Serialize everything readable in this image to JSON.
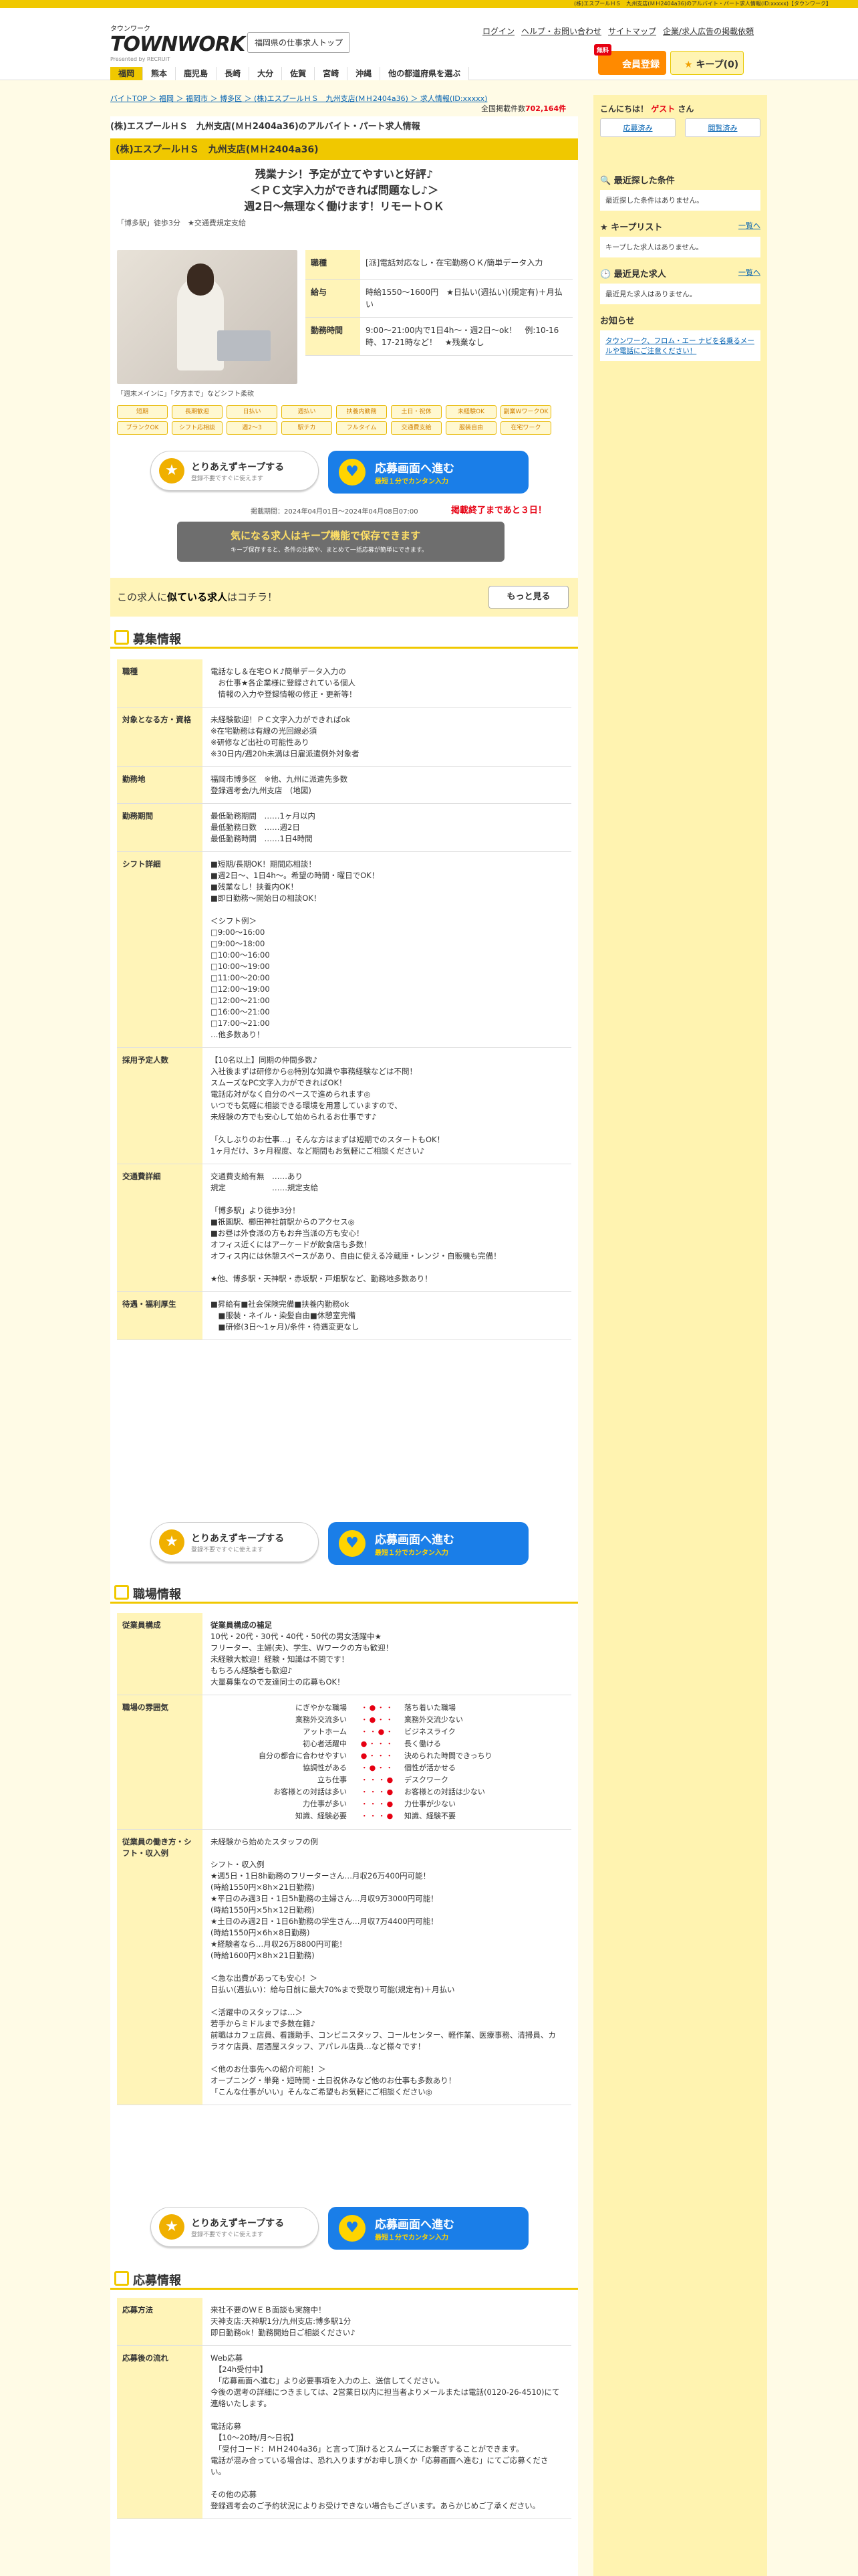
{
  "topbar": "(株)エスプールＨＳ　九州支店(ＭＨ2404a36)のアルバイト・パート求人情報(ID:xxxxx)【タウンワーク】",
  "header": {
    "logo_small": "タウンワーク",
    "logo_big": "TOWNWORK",
    "logo_by": "Presented by RECRUIT",
    "local_button": "福岡県の仕事求人トップ",
    "links": [
      "ログイン",
      "ヘルプ・お問い合わせ",
      "サイトマップ",
      "企業/求人広告の掲載依頼"
    ],
    "member_tag": "無料",
    "member": "会員登録",
    "keep": "キープ(0)"
  },
  "nav": [
    "福岡",
    "熊本",
    "鹿児島",
    "長崎",
    "大分",
    "佐賀",
    "宮崎",
    "沖縄",
    "他の都道府県を選ぶ"
  ],
  "breadcrumb": "バイトTOP ＞ 福岡 ＞ 福岡市 ＞ 博多区 ＞ (株)エスプールＨＳ　九州支店(ＭＨ2404a36) ＞ 求人情報(ID:xxxxx)",
  "count_label": "全国掲載件数",
  "count": "702,164件",
  "job": {
    "title": "(株)エスプールＨＳ　九州支店(ＭＨ2404a36)のアルバイト・パート求人情報",
    "bar": "(株)エスプールＨＳ　九州支店(ＭＨ2404a36)",
    "catch1": "残業ナシ！予定が立てやすいと好評♪",
    "catch2": "＜ＰＣ文字入力ができれば問題なし♪＞",
    "catch3": "週2日～無理なく働けます！リモートＯＫ",
    "sub": "「博多駅」徒歩3分　★交通費規定支給",
    "photo_caption": "「週末メインに」「夕方まで」などシフト柔軟",
    "summary": [
      {
        "k": "職種",
        "v": "[派]電話対応なし・在宅勤務ＯＫ/簡単データ入力"
      },
      {
        "k": "給与",
        "v": "時給1550～1600円　★日払い(週払い)(規定有)＋月払い"
      },
      {
        "k": "勤務時間",
        "v": "9:00～21:00内で1日4h～・週2日～ok！　例:10-16時、17-21時など！　★残業なし"
      }
    ],
    "tags": [
      "短期",
      "長期歓迎",
      "日払い",
      "週払い",
      "扶養内勤務",
      "土日・祝休",
      "未経験OK",
      "副業WワークOK",
      "ブランクOK",
      "シフト応相談",
      "週2〜3",
      "駅チカ",
      "フルタイム",
      "交通費支給",
      "服装自由",
      "在宅ワーク"
    ],
    "keep_btn": "とりあえずキープする",
    "keep_sub": "登録不要ですぐに使えます",
    "apply_btn": "応募画面へ進む",
    "apply_sub": "最短１分でカンタン入力",
    "period": "掲載期間：2024年04月01日～2024年04月08日07:00",
    "remain": "掲載終了まであと３日！",
    "banner_title": "気になる求人はキープ機能で保存できます",
    "banner_sub": "キープ保存すると、条件の比較や、まとめて一括応募が簡単にできます。",
    "similar": "この求人に",
    "similar_b": "似ている求人",
    "similar2": "はコチラ！",
    "more": "もっと見る"
  },
  "sections": {
    "bosyu": "募集情報",
    "shokuba": "職場情報",
    "oubo": "応募情報"
  },
  "bosyu": [
    {
      "k": "職種",
      "v": "電話なし＆在宅ＯＫ♪簡単データ入力の\n　お仕事★各企業様に登録されている個人\n　情報の入力や登録情報の修正・更新等！"
    },
    {
      "k": "対象となる方・資格",
      "v": "未経験歓迎！ＰＣ文字入力ができればok\n※在宅勤務は有線の光回線必須\n※研修など出社の可能性あり\n※30日内/週20h未満は日雇派遣例外対象者"
    },
    {
      "k": "勤務地",
      "v": "福岡市博多区　※他、九州に派遣先多数\n登録週考会/九州支店　(地図)"
    },
    {
      "k": "勤務期間",
      "v": "最低勤務期間　……1ヶ月以内\n最低勤務日数　……週2日\n最低勤務時間　……1日4時間"
    },
    {
      "k": "シフト詳細",
      "v": "■短期/長期OK！期間応相談！\n■週2日～、1日4h～。希望の時間・曜日でOK！\n■残業なし！扶養内OK！\n■即日勤務～開始日の相談OK！\n\n＜シフト例＞\n□9:00～16:00\n□9:00～18:00\n□10:00～16:00\n□10:00～19:00\n□11:00～20:00\n□12:00～19:00\n□12:00～21:00\n□16:00～21:00\n□17:00～21:00\n…他多数あり！"
    },
    {
      "k": "採用予定人数",
      "v": "【10名以上】同期の仲間多数♪\n入社後まずは研修から◎特別な知識や事務経験などは不問！\nスムーズなPC文字入力ができればOK！\n電話応対がなく自分のペースで進められます◎\nいつでも気軽に相談できる環境を用意していますので、\n未経験の方でも安心して始められるお仕事です♪\n\n「久しぶりのお仕事…」そんな方はまずは短期でのスタートもOK！\n1ヶ月だけ、3ヶ月程度、など期間もお気軽にご相談ください♪"
    },
    {
      "k": "交通費詳細",
      "v": "交通費支給有無　……あり\n規定　　　　　　……規定支給\n\n「博多駅」より徒歩3分！\n■祇園駅、櫛田神社前駅からのアクセス◎\n■お昼は外食派の方もお弁当派の方も安心！\nオフィス近くにはアーケードが飲食店も多数！\nオフィス内には休憩スペースがあり、自由に使える冷蔵庫・レンジ・自販機も完備！\n\n★他、博多駅・天神駅・赤坂駅・戸畑駅など、勤務地多数あり！"
    },
    {
      "k": "待遇・福利厚生",
      "v": "■昇給有■社会保険完備■扶養内勤務ok\n　■服装・ネイル・染髪自由■休憩室完備\n　■研修(3日～1ヶ月)/条件・待遇変更なし"
    }
  ],
  "shokuba_comp_head": "従業員構成の補足",
  "shokuba_comp": "10代・20代・30代・40代・50代の男女活躍中★\nフリーター、主婦(夫)、学生、Wワークの方も歓迎！\n未経験大歓迎！経験・知識は不問です！\nもちろん経験者も歓迎♪\n大量募集なので友達同士の応募もOK！",
  "mood": [
    [
      "にぎやかな職場",
      "落ち着いた職場"
    ],
    [
      "業務外交流多い",
      "業務外交流少ない"
    ],
    [
      "アットホーム",
      "ビジネスライク"
    ],
    [
      "初心者活躍中",
      "長く働ける"
    ],
    [
      "自分の都合に合わせやすい",
      "決められた時間できっちり"
    ],
    [
      "協調性がある",
      "個性が活かせる"
    ],
    [
      "立ち仕事",
      "デスクワーク"
    ],
    [
      "お客様との対話は多い",
      "お客様との対話は少ない"
    ],
    [
      "力仕事が多い",
      "力仕事が少ない"
    ],
    [
      "知識、経験必要",
      "知識、経験不要"
    ]
  ],
  "shokuba_rows": [
    {
      "k": "従業員構成"
    },
    {
      "k": "職場の雰囲気"
    },
    {
      "k": "従業員の働き方・シフト・収入例",
      "v": "未経験から始めたスタッフの例\n\nシフト・収入例\n★週5日・1日8h勤務のフリーターさん…月収26万400円可能！\n(時給1550円×8h×21日勤務)\n★平日のみ週3日・1日5h勤務の主婦さん…月収9万3000円可能！\n(時給1550円×5h×12日勤務)\n★土日のみ週2日・1日6h勤務の学生さん…月収7万4400円可能！\n(時給1550円×6h×8日勤務)\n★経験者なら…月収26万8800円可能！\n(時給1600円×8h×21日勤務)\n\n＜急な出費があっても安心！＞\n日払い(週払い)：給与日前に最大70%まで受取り可能(規定有)＋月払い\n\n＜活躍中のスタッフは…＞\n若手からミドルまで多数在籍♪\n前職はカフェ店員、看護助手、コンビニスタッフ、コールセンター、軽作業、医療事務、清掃員、カラオケ店員、居酒屋スタッフ、アパレル店員…など様々です！\n\n＜他のお仕事先への紹介可能！＞\nオープニング・単発・短時間・土日祝休みなど他のお仕事も多数あり！\n「こんな仕事がいい」そんなご希望もお気軽にご相談ください◎"
    }
  ],
  "oubo": [
    {
      "k": "応募方法",
      "v": "来社不要のＷＥＢ面談も実施中！\n天神支店:天神駅1分/九州支店:博多駅1分\n即日勤務ok！勤務開始日ご相談ください♪"
    },
    {
      "k": "応募後の流れ",
      "v": "Web応募\n　【24h受付中】\n　「応募画面へ進む」より必要事項を入力の上、送信してください。\n今後の選考の詳細につきましては、2営業日以内に担当者よりメールまたは電話(0120-26-4510)にて連絡いたします。\n\n電話応募\n　【10～20時/月～日祝】\n　「受付コード：ＭＨ2404a36」と言って頂けるとスムーズにお繋ぎすることができます。\n電話が混み合っている場合は、恐れ入りますがお申し頂くか「応募画面へ進む」にてご応募ください。\n\nその他の応募\n登録週考会のご予約状況によりお受けできない場合もございます。あらかじめご了承ください。"
    }
  ],
  "side": {
    "hello": "こんにちは！",
    "guest": "ゲスト",
    "san": "さん",
    "reg": "応募済み",
    "history": "閲覧済み",
    "recent_cond": "最近探した条件",
    "recent_cond_v": "最近探した条件はありません。",
    "keep": "キープリスト",
    "keep_link": "一覧へ",
    "keep_v": "キープした求人はありません。",
    "viewed": "最近見た求人",
    "viewed_link": "一覧へ",
    "viewed_v": "最近見た求人はありません。",
    "notice": "お知らせ",
    "notice_v": "タウンワーク、フロム・エー ナビを名乗るメールや電話にご注意ください！"
  }
}
